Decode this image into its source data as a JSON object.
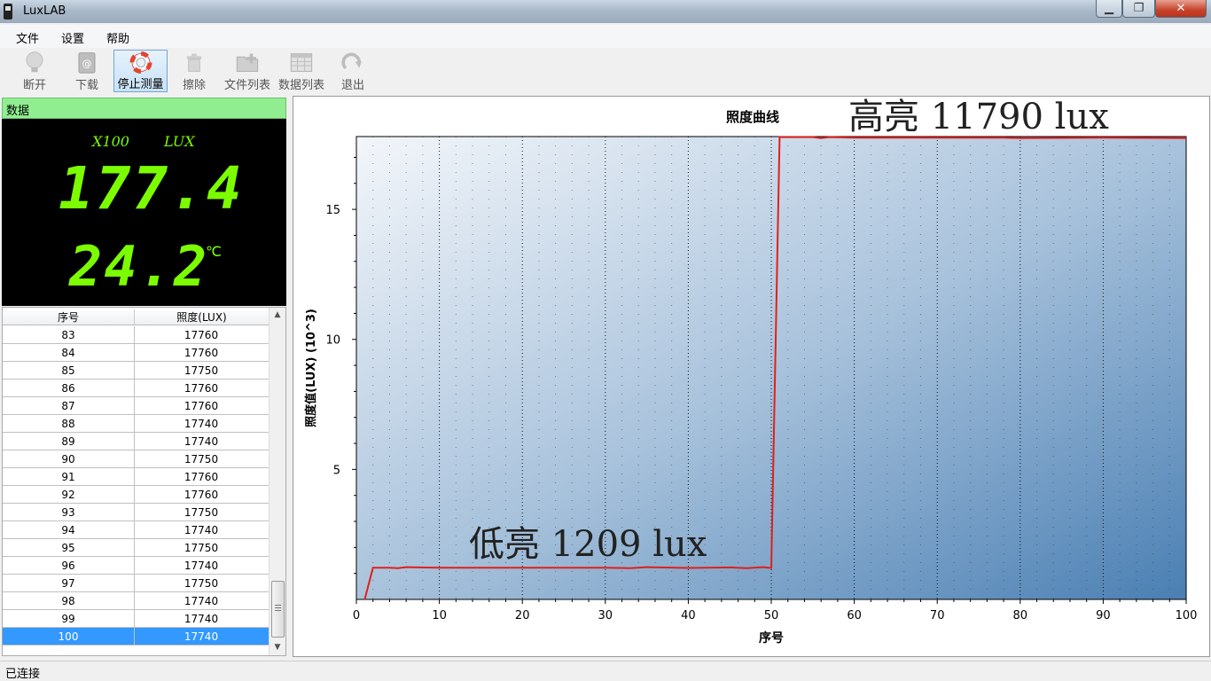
{
  "window": {
    "title": "LuxLAB",
    "min_label": "▁",
    "max_label": "❐",
    "close_label": "✕"
  },
  "menu": [
    "文件",
    "设置",
    "帮助"
  ],
  "toolbar": {
    "disconnect": "断开",
    "download": "下载",
    "stop_measure": "停止测量",
    "erase": "擦除",
    "file_list": "文件列表",
    "data_list": "数据列表",
    "exit": "退出"
  },
  "left_panel": {
    "header": "数据",
    "display": {
      "multiplier": "X100",
      "unit": "LUX",
      "lux_value": "177.4",
      "temp_value": "24.2",
      "temp_unit": "℃"
    },
    "table": {
      "columns": [
        "序号",
        "照度(LUX)"
      ],
      "rows": [
        [
          "83",
          "17760"
        ],
        [
          "84",
          "17760"
        ],
        [
          "85",
          "17750"
        ],
        [
          "86",
          "17760"
        ],
        [
          "87",
          "17760"
        ],
        [
          "88",
          "17740"
        ],
        [
          "89",
          "17740"
        ],
        [
          "90",
          "17750"
        ],
        [
          "91",
          "17760"
        ],
        [
          "92",
          "17760"
        ],
        [
          "93",
          "17750"
        ],
        [
          "94",
          "17740"
        ],
        [
          "95",
          "17750"
        ],
        [
          "96",
          "17740"
        ],
        [
          "97",
          "17750"
        ],
        [
          "98",
          "17740"
        ],
        [
          "99",
          "17740"
        ],
        [
          "100",
          "17740"
        ]
      ],
      "selected_row": "100"
    }
  },
  "chart_data": {
    "type": "line",
    "title": "照度曲线",
    "xlabel": "序号",
    "ylabel": "照度值(LUX)  (10^3)",
    "xlim": [
      0,
      100
    ],
    "ylim": [
      0,
      17.8
    ],
    "xticks": [
      0,
      10,
      20,
      30,
      40,
      50,
      60,
      70,
      80,
      90,
      100
    ],
    "yticks": [
      5,
      10,
      15
    ],
    "grid": true,
    "line_color": "#e0201c",
    "annotations": [
      "高亮 11790 lux",
      "低亮 1209 lux"
    ],
    "series": [
      {
        "x": [
          1,
          2,
          4,
          5,
          6,
          10,
          20,
          30,
          33,
          35,
          40,
          45,
          47,
          49,
          50,
          51,
          55,
          56,
          57,
          60,
          70,
          78,
          80,
          90,
          100
        ],
        "y": [
          0,
          1.22,
          1.22,
          1.2,
          1.24,
          1.22,
          1.22,
          1.22,
          1.2,
          1.24,
          1.21,
          1.23,
          1.2,
          1.24,
          1.21,
          17.78,
          17.78,
          17.74,
          17.78,
          17.76,
          17.76,
          17.76,
          17.74,
          17.76,
          17.74
        ]
      }
    ]
  },
  "status": {
    "text": "已连接"
  }
}
